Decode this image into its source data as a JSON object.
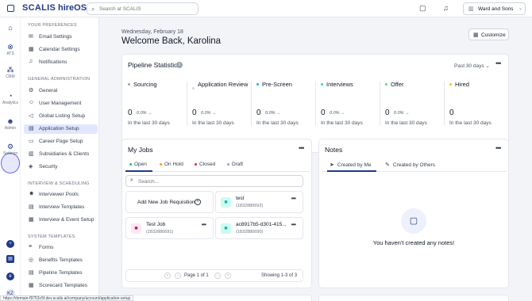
{
  "app": {
    "brand": "SCALIS",
    "product": "hireOS"
  },
  "topbar": {
    "search_placeholder": "Search at SCALIS",
    "company": "Ward and Sons"
  },
  "rail": {
    "items": [
      {
        "label": ""
      },
      {
        "label": "ATS"
      },
      {
        "label": "CRM"
      },
      {
        "label": "Analytics"
      },
      {
        "label": "Admin"
      },
      {
        "label": "Settings"
      }
    ],
    "avatar": "KZ"
  },
  "menu": {
    "sections": [
      {
        "title": "YOUR PREFERENCES",
        "items": [
          "Email Settings",
          "Calendar Settings",
          "Notifications"
        ]
      },
      {
        "title": "GENERAL ADMINISTRATION",
        "items": [
          "General",
          "User Management",
          "Global Listing Setup",
          "Application Setup",
          "Career Page Setup",
          "Subsidiaries & Clients",
          "Security"
        ]
      },
      {
        "title": "INTERVIEW & SCHEDULING",
        "items": [
          "Interviewer Pools",
          "Interview Templates",
          "Interview & Event Setup"
        ]
      },
      {
        "title": "SYSTEM TEMPLATES",
        "items": [
          "Forms",
          "Benefits Templates",
          "Pipeline Templates",
          "Scorecard Templates"
        ]
      }
    ],
    "active_item": "Application Setup"
  },
  "header": {
    "date": "Wednesday, February 18",
    "welcome": "Welcome Back, Karolina",
    "customize": "Customize"
  },
  "pipeline": {
    "title": "Pipeline Statistics",
    "period": "Past 30 days",
    "stages": [
      {
        "label": "Sourcing",
        "value": "0",
        "change": "0.0% →",
        "sub": "In the last 30 days",
        "color": "#9ca3af"
      },
      {
        "label": "Application Review",
        "value": "0",
        "change": "0.0% →",
        "sub": "In the last 30 days",
        "color": "#d1d5db"
      },
      {
        "label": "Pre-Screen",
        "value": "0",
        "change": "0.0% →",
        "sub": "In the last 30 days",
        "color": "#22b8cf"
      },
      {
        "label": "Interviews",
        "value": "0",
        "change": "0.0% →",
        "sub": "In the last 30 days",
        "color": "#2dd4bf"
      },
      {
        "label": "Offer",
        "value": "0",
        "change": "0.0% →",
        "sub": "In the last 30 days",
        "color": "#4ade80"
      },
      {
        "label": "Hired",
        "value": "0",
        "change": "",
        "sub": "In the last 30 days",
        "color": "#facc15"
      }
    ]
  },
  "myjobs": {
    "title": "My Jobs",
    "tabs": [
      {
        "label": "Open",
        "color": "#22c55e"
      },
      {
        "label": "On Hold",
        "color": "#f59e0b"
      },
      {
        "label": "Closed",
        "color": "#dc2626"
      },
      {
        "label": "Draft",
        "color": "#9ca3af"
      }
    ],
    "search_placeholder": "Search...",
    "add_label": "Add New Job Requisition",
    "jobs": [
      {
        "name": "test",
        "id": "(1832880692)",
        "color": "#14b8a6",
        "bg": "#ccfbf1"
      },
      {
        "name": "Test Job",
        "id": "(1832880691)",
        "color": "#be185d",
        "bg": "#fce7f3"
      },
      {
        "name": "ac8917b5-d301-415...",
        "id": "(1832880690)",
        "color": "#14b8a6",
        "bg": "#ccfbf1"
      }
    ],
    "pagination": {
      "page_text": "Page 1 of 1",
      "showing": "Showing 1-3 of 3"
    }
  },
  "notes": {
    "title": "Notes",
    "tabs": [
      "Created by Me",
      "Created by Others"
    ],
    "empty": "You haven't created any notes!"
  },
  "status_url": "https://domain-f9753c5f.dev.scalis.ai/company/account/application-setup"
}
